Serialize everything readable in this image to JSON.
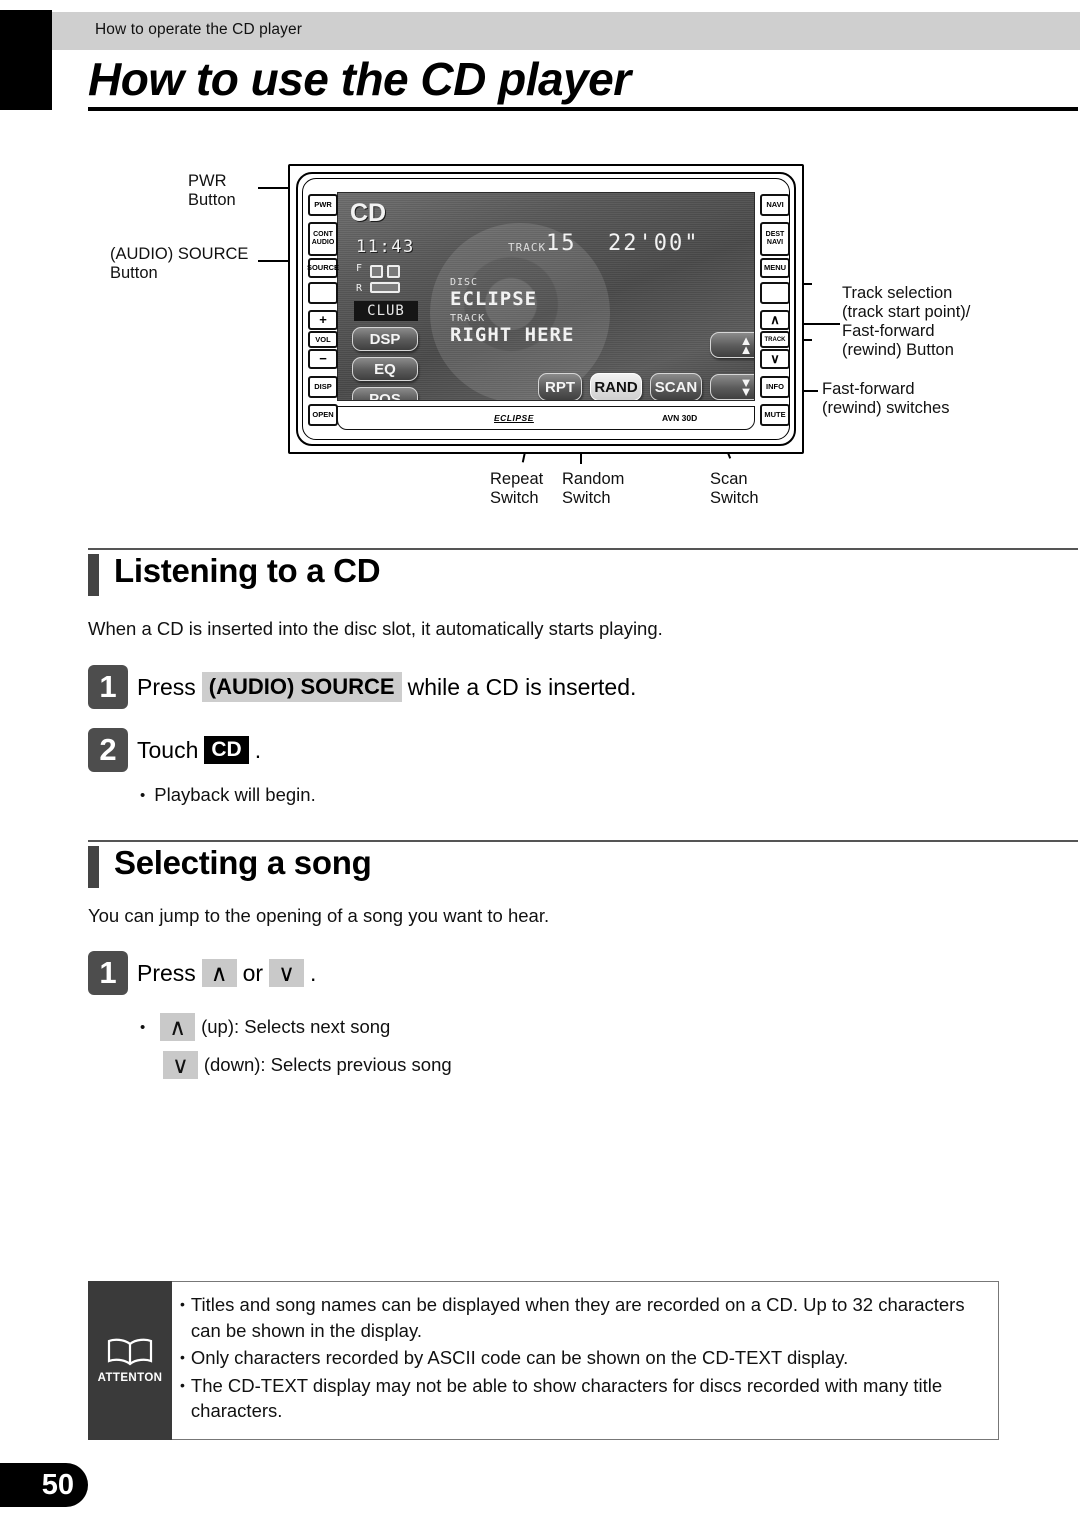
{
  "header": {
    "breadcrumb": "How to operate the CD player",
    "title": "How to use the CD player"
  },
  "diagram": {
    "callouts": {
      "pwr_button": "PWR\nButton",
      "audio_source_button": "(AUDIO) SOURCE\nButton",
      "track_selection": "Track selection\n(track start point)/\nFast-forward\n(rewind) Button",
      "fast_forward_switches": "Fast-forward\n(rewind) switches",
      "repeat_switch": "Repeat\nSwitch",
      "random_switch": "Random\nSwitch",
      "scan_switch": "Scan\nSwitch"
    },
    "left_keys": [
      "PWR",
      "CONT",
      "AUDIO",
      "SOURCE",
      "",
      "+",
      "VOL",
      "−",
      "DISP",
      "OPEN"
    ],
    "right_keys": [
      "NAVI",
      "DEST",
      "NAVI",
      "MENU",
      "",
      "∧",
      "TRACK",
      "∨",
      "INFO",
      "MUTE"
    ],
    "screen": {
      "mode": "CD",
      "clock": "11:43",
      "speaker_front": "F",
      "speaker_rear": "R",
      "eq_preset": "CLUB",
      "track_label": "TRACK",
      "track_number": "15",
      "elapsed_time": "22'00\"",
      "disc_label": "DISC",
      "disc_name": "ECLIPSE",
      "song_label": "TRACK",
      "song_name": "RIGHT HERE",
      "soft_buttons": [
        "DSP",
        "EQ",
        "POS"
      ],
      "mode_buttons": [
        "RPT",
        "RAND",
        "SCAN"
      ],
      "ff_arrow": "▲",
      "rew_arrow": "▼"
    },
    "bezel": {
      "brand": "ECLIPSE",
      "model": "AVN 30D"
    }
  },
  "sections": [
    {
      "heading": "Listening to a CD",
      "intro": "When a CD is inserted into the disc slot, it automatically starts playing.",
      "steps": [
        {
          "num": "1",
          "pre": "Press",
          "key": "(AUDIO) SOURCE",
          "post": "while a CD is inserted."
        },
        {
          "num": "2",
          "pre": "Touch",
          "key": "CD",
          "post": "."
        }
      ],
      "bullets": [
        "Playback will begin."
      ]
    },
    {
      "heading": "Selecting a song",
      "intro": "You can jump to the opening of a song you want to hear.",
      "steps": [
        {
          "num": "1",
          "pre": "Press",
          "key_up": "∧",
          "mid": "or",
          "key_down": "∨",
          "post": "."
        }
      ],
      "bullets_arrow": [
        {
          "arrow": "∧",
          "text": "(up): Selects next song"
        },
        {
          "arrow": "∨",
          "text": "(down): Selects previous song"
        }
      ]
    }
  ],
  "attention": {
    "word": "ATTENTON",
    "items": [
      "Titles and song names can be displayed when they are recorded on a CD.  Up to 32 characters can be shown in the display.",
      "Only characters recorded by ASCII code can be shown on the CD-TEXT display.",
      "The CD-TEXT display may not be able to show characters for discs recorded with many title characters."
    ]
  },
  "page_number": "50",
  "colors": {
    "header_bar": "#cfcfcf",
    "step_badge": "#4d4d4d",
    "key_highlight": "#cdcdcd",
    "attention_panel": "#3a3a3a"
  }
}
